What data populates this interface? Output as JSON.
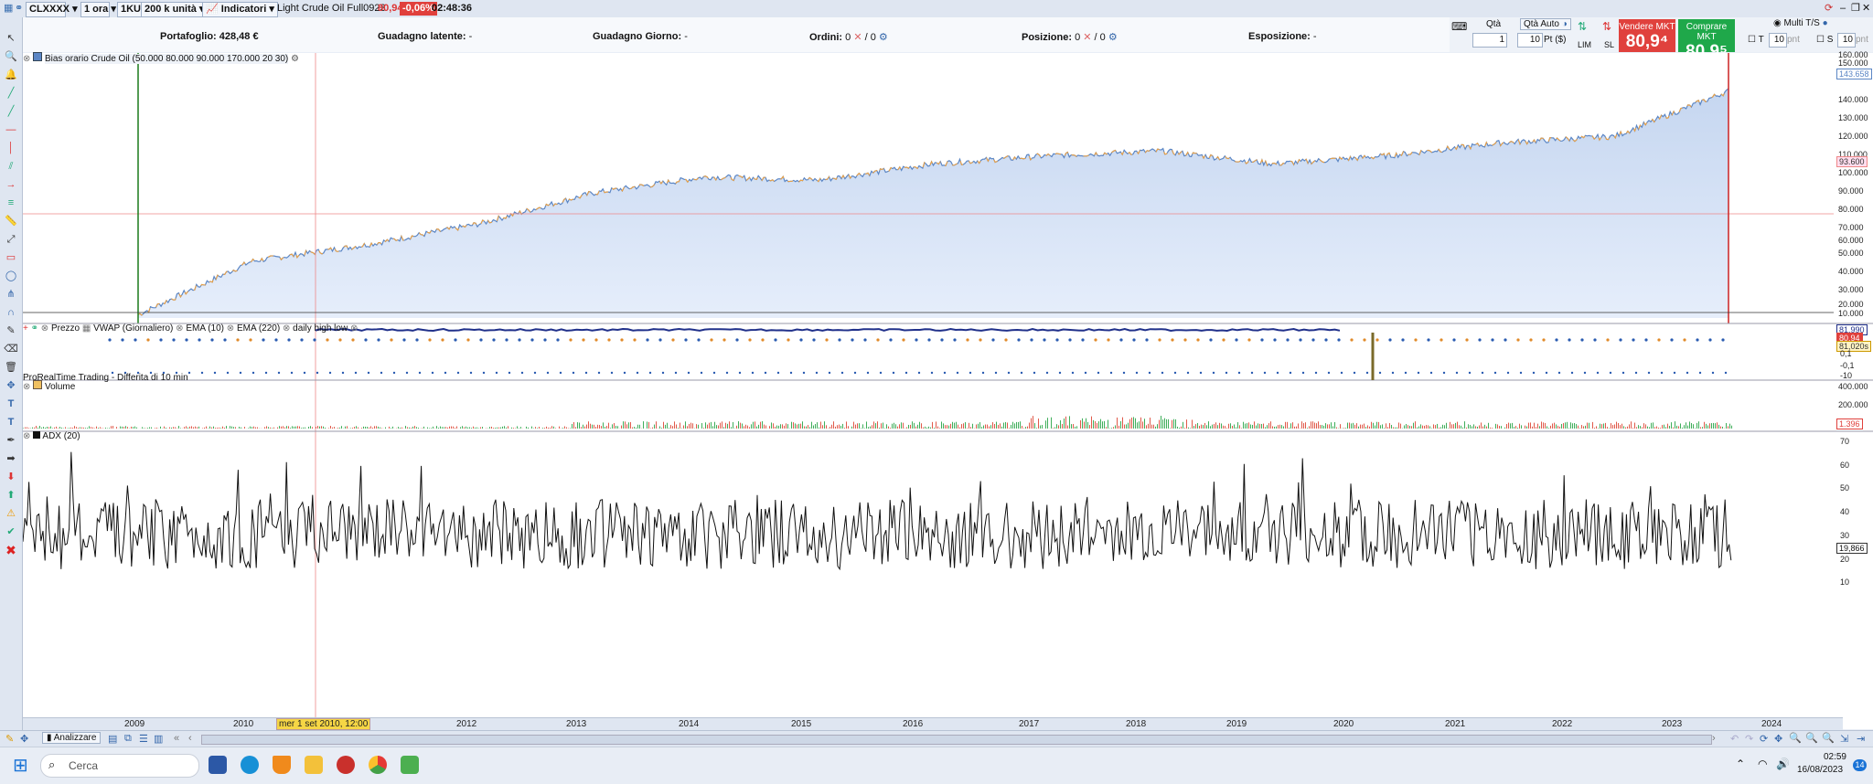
{
  "topbar": {
    "symbol": "CLXXXX",
    "timeframe": "1 ora",
    "units_prefix": "1KU",
    "units": "200 k unità",
    "indicators": "Indicatori",
    "instrument": "Light Crude Oil Full0923",
    "price": "80,94",
    "change": "-0,06%",
    "time": "02:48:36"
  },
  "account": {
    "portfolio": "Portafoglio: 428,48 €",
    "latent_label": "Guadagno latente:",
    "latent_value": "-",
    "day_label": "Guadagno Giorno:",
    "day_value": "-",
    "orders_label": "Ordini:",
    "orders_a": "0",
    "orders_b": "/ 0",
    "position_label": "Posizione:",
    "position_a": "0",
    "position_b": "/ 0",
    "exposure_label": "Esposizione:",
    "exposure_value": "-"
  },
  "order_panel": {
    "qty_label": "Qtà",
    "qty_auto_label": "Qtà Auto",
    "qty_value": "1",
    "pts_value": "10",
    "pts_unit": "Pt ($)",
    "lim": "LIM",
    "sl": "SL",
    "sell_label": "Vendere MKT",
    "sell_price": "80,9⁴",
    "buy_label": "Comprare MKT",
    "buy_price": "80,9⁵",
    "multi_ts": "Multi T/S",
    "t_label": "T",
    "t_value": "10",
    "t_unit": "pnt",
    "s_label": "S",
    "s_value": "10",
    "s_unit": "pnt",
    "colors": {
      "sell": "#e0413d",
      "buy": "#1fa84a"
    }
  },
  "main_panel": {
    "title": "Bias orario Crude Oil (50.000 80.000 90.000 170.000 20 30)",
    "y_labels": [
      "160.000",
      "150.000",
      "140.000",
      "130.000",
      "120.000",
      "110.000",
      "100.000",
      "90.000",
      "80.000",
      "70.000",
      "60.000",
      "50.000",
      "40.000",
      "30.000",
      "20.000",
      "10.000"
    ],
    "last_tag": "143.658",
    "cross_tag": "93.600"
  },
  "price_panel": {
    "tabs": [
      "Prezzo",
      "VWAP (Giornaliero)",
      "EMA (10)",
      "EMA (220)",
      "daily high low"
    ],
    "note": "ProRealTime Trading - Differita di 10 min",
    "tags": [
      "81,990",
      "80,94",
      "81,020s"
    ],
    "y_labels": [
      "0,1",
      "-0,1",
      "-10"
    ]
  },
  "volume_panel": {
    "title": "Volume",
    "y_labels": [
      "400.000",
      "200.000"
    ],
    "tag": "1.396"
  },
  "adx_panel": {
    "title": "ADX (20)",
    "y_labels": [
      "70",
      "60",
      "50",
      "40",
      "30",
      "20",
      "10"
    ],
    "tag": "19,866"
  },
  "x_axis": {
    "years": [
      "2009",
      "2010",
      "2011",
      "2012",
      "2013",
      "2014",
      "2015",
      "2016",
      "2017",
      "2018",
      "2019",
      "2020",
      "2021",
      "2022",
      "2023",
      "2024"
    ],
    "cursor_date": "mer 1 set 2010, 12:00"
  },
  "chart_data": {
    "type": "area",
    "title": "Bias orario Crude Oil (50.000 80.000 90.000 170.000 20 30)",
    "x": [
      "2009",
      "2010",
      "2011",
      "2012",
      "2013",
      "2014",
      "2015",
      "2016",
      "2017",
      "2018",
      "2019",
      "2020",
      "2021",
      "2022",
      "2023"
    ],
    "series": [
      {
        "name": "Bias orario Crude Oil",
        "values": [
          2000,
          35000,
          45000,
          58000,
          77000,
          87000,
          85000,
          95000,
          100000,
          103000,
          95000,
          100000,
          108000,
          112000,
          140000
        ]
      }
    ],
    "ylim": [
      0,
      160000
    ]
  },
  "bottom": {
    "analyzer": "Analizzare"
  },
  "taskbar": {
    "search": "Cerca",
    "time": "02:59",
    "date": "16/08/2023",
    "badge": "14"
  }
}
